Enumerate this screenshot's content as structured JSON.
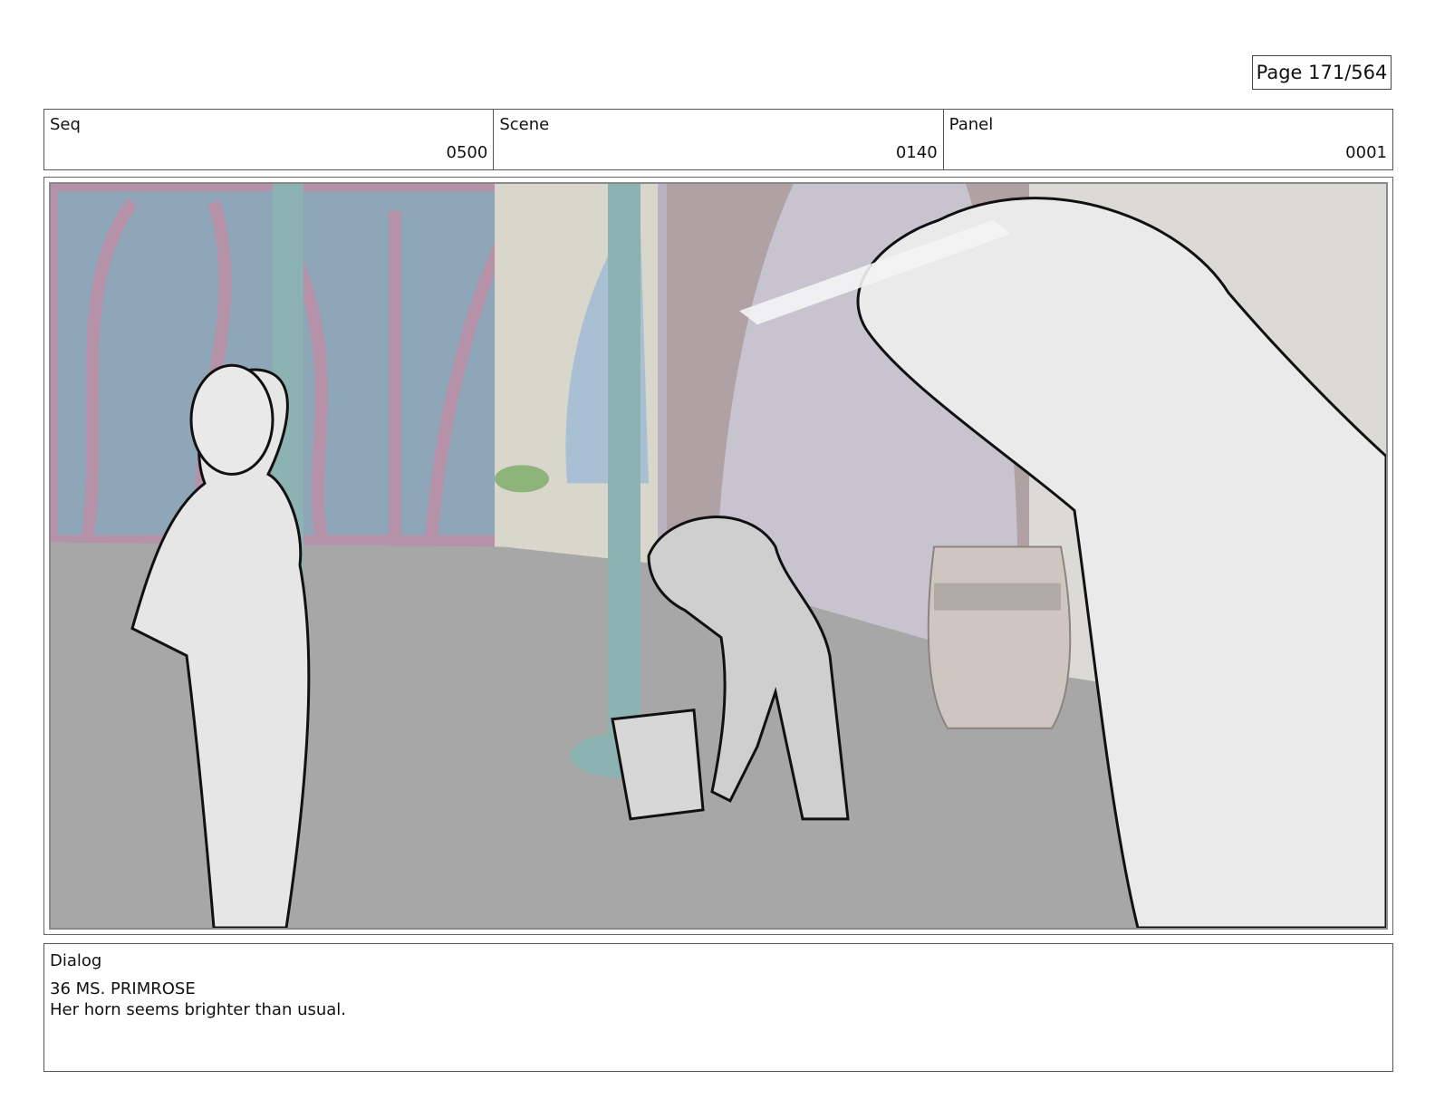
{
  "page": {
    "label": "Page 171/564"
  },
  "header": {
    "seq": {
      "label": "Seq",
      "value": "0500"
    },
    "scene": {
      "label": "Scene",
      "value": "0140"
    },
    "panel": {
      "label": "Panel",
      "value": "0001"
    }
  },
  "panel_image": {
    "description_icon": "storyboard-frame-image"
  },
  "dialog": {
    "label": "Dialog",
    "speaker": "36 MS. PRIMROSE",
    "line": "Her horn seems brighter than usual."
  },
  "colors": {
    "border": "#555555",
    "floor": "#a7a7a7",
    "wall_pink": "#b592a8",
    "wall_blue": "#8fa6b8",
    "pillar": "#8cb3b1"
  }
}
